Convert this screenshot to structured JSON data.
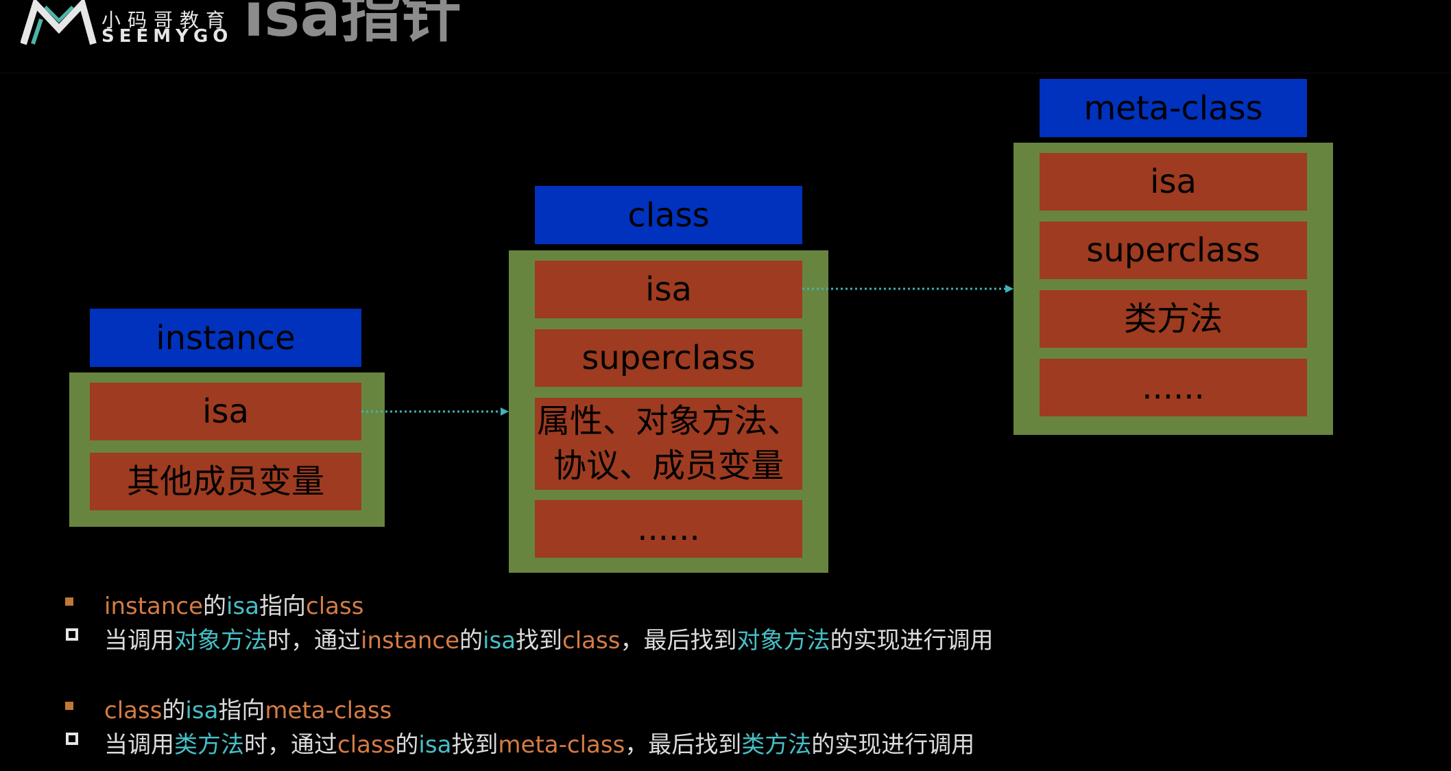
{
  "header": {
    "logo_cn": "小码哥教育",
    "logo_en": "SEEMYGO",
    "title": "isa指针"
  },
  "diagram": {
    "instance": {
      "label": "instance",
      "rows": [
        "isa",
        "其他成员变量"
      ]
    },
    "class": {
      "label": "class",
      "rows": [
        "isa",
        "superclass",
        "属性、对象方法、协议、成员变量",
        "......"
      ]
    },
    "meta_class": {
      "label": "meta-class",
      "rows": [
        "isa",
        "superclass",
        "类方法",
        "......"
      ]
    }
  },
  "notes": [
    {
      "heading": [
        {
          "text": "instance",
          "color": "orange"
        },
        {
          "text": "的",
          "color": "white"
        },
        {
          "text": "isa",
          "color": "teal"
        },
        {
          "text": "指向",
          "color": "white"
        },
        {
          "text": "class",
          "color": "orange"
        }
      ],
      "detail": [
        {
          "text": "当调用",
          "color": "white"
        },
        {
          "text": "对象方法",
          "color": "teal"
        },
        {
          "text": "时，通过",
          "color": "white"
        },
        {
          "text": "instance",
          "color": "orange"
        },
        {
          "text": "的",
          "color": "white"
        },
        {
          "text": "isa",
          "color": "teal"
        },
        {
          "text": "找到",
          "color": "white"
        },
        {
          "text": "class",
          "color": "orange"
        },
        {
          "text": "，最后找到",
          "color": "white"
        },
        {
          "text": "对象方法",
          "color": "teal"
        },
        {
          "text": "的实现进行调用",
          "color": "white"
        }
      ]
    },
    {
      "heading": [
        {
          "text": "class",
          "color": "orange"
        },
        {
          "text": "的",
          "color": "white"
        },
        {
          "text": "isa",
          "color": "teal"
        },
        {
          "text": "指向",
          "color": "white"
        },
        {
          "text": "meta-class",
          "color": "orange"
        }
      ],
      "detail": [
        {
          "text": "当调用",
          "color": "white"
        },
        {
          "text": "类方法",
          "color": "teal"
        },
        {
          "text": "时，通过",
          "color": "white"
        },
        {
          "text": "class",
          "color": "orange"
        },
        {
          "text": "的",
          "color": "white"
        },
        {
          "text": "isa",
          "color": "teal"
        },
        {
          "text": "找到",
          "color": "white"
        },
        {
          "text": "meta-class",
          "color": "orange"
        },
        {
          "text": "，最后找到",
          "color": "white"
        },
        {
          "text": "类方法",
          "color": "teal"
        },
        {
          "text": "的实现进行调用",
          "color": "white"
        }
      ]
    }
  ],
  "colors": {
    "background": "#000000",
    "header_blue": "#0132bd",
    "field_red": "#9e3b20",
    "container_green": "#68853f",
    "arrow_teal": "#3fb3b8",
    "text_orange": "#d57c45",
    "text_teal": "#46bfc6"
  }
}
